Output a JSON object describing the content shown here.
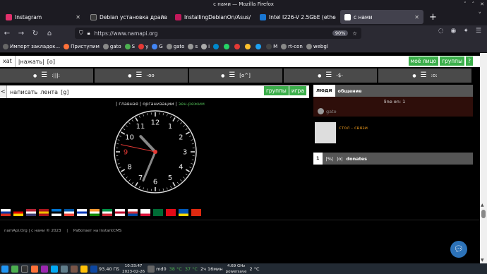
{
  "window": {
    "title": "с нами — Mozilla Firefox",
    "controls": [
      "˅",
      "˄",
      "✕"
    ]
  },
  "tabs": [
    {
      "label": "Instagram",
      "color": "#e1306c",
      "active": false
    },
    {
      "label": "Debian установка драйв",
      "color": "#3a3a3a",
      "active": false
    },
    {
      "label": "InstallingDebianOn/Asus/",
      "color": "#c2185b",
      "active": false
    },
    {
      "label": "Intel I226-V 2.5GbE (ethe",
      "color": "#1976d2",
      "active": false
    },
    {
      "label": "с нами",
      "color": "#ffffff",
      "active": true
    }
  ],
  "navbar": {
    "url": "https://www.namapi.org",
    "zoom": "90%"
  },
  "bookmarks": [
    {
      "label": "Импорт закладок...",
      "color": "#666"
    },
    {
      "label": "Приступим",
      "color": "#ff7139"
    },
    {
      "label": "gato",
      "color": "#888"
    },
    {
      "label": "S",
      "color": "#4caf50"
    },
    {
      "label": "y",
      "color": "#e53935"
    },
    {
      "label": "G",
      "color": "#4285f4"
    },
    {
      "label": "gato",
      "color": "#888"
    },
    {
      "label": "s",
      "color": "#999"
    },
    {
      "label": "i",
      "color": "#aaa"
    },
    {
      "label": "",
      "color": "#0088cc"
    },
    {
      "label": "",
      "color": "#25d366"
    },
    {
      "label": "",
      "color": "#e53935"
    },
    {
      "label": "",
      "color": "#fbc02d"
    },
    {
      "label": "",
      "color": "#1da1f2"
    },
    {
      "label": "M",
      "color": "#444"
    },
    {
      "label": "rt-con",
      "color": "#888"
    },
    {
      "label": "webgl",
      "color": "#888"
    }
  ],
  "site": {
    "xat": "xat",
    "press": "|нажать|",
    "o": "[o]",
    "my_face": "моё лицо",
    "groups": "группы",
    "help": "?",
    "filters": [
      ":|||:",
      "-oo",
      "[o^]",
      "-$-",
      ":o:"
    ],
    "left_bar": {
      "back": "<",
      "write": "написать",
      "feed": "лента",
      "g": "[g]",
      "groups": "группы",
      "game": "игра"
    },
    "nav_links": {
      "main": "главная",
      "orgs": "организации",
      "zen": "зен-режим"
    },
    "people": {
      "tab": "люди",
      "label": "общение",
      "line_on": "line on: 1",
      "guest": "gato"
    },
    "post_title": "стол - связи",
    "donate": {
      "num": "1",
      "pct": "|%|",
      "o": "|o|",
      "label": "donates"
    },
    "footer": {
      "site": "namApi.Org | с нами © 2023",
      "cms": "Работает на InstantCMS"
    }
  },
  "flags": [
    {
      "name": "russia",
      "colors": [
        "#fff",
        "#0039a6",
        "#d52b1e"
      ]
    },
    {
      "name": "germany",
      "colors": [
        "#000",
        "#dd0000",
        "#ffce00"
      ]
    },
    {
      "name": "usa",
      "colors": [
        "#b22234",
        "#fff",
        "#3c3b6e"
      ]
    },
    {
      "name": "spain",
      "colors": [
        "#aa151b",
        "#f1bf00",
        "#aa151b"
      ]
    },
    {
      "name": "estonia",
      "colors": [
        "#0072ce",
        "#000",
        "#fff"
      ]
    },
    {
      "name": "france",
      "colors": [
        "#0055a4",
        "#fff",
        "#ef4135"
      ]
    },
    {
      "name": "israel",
      "colors": [
        "#fff",
        "#0038b8",
        "#fff"
      ]
    },
    {
      "name": "india",
      "colors": [
        "#ff9933",
        "#fff",
        "#138808"
      ]
    },
    {
      "name": "italy",
      "colors": [
        "#009246",
        "#fff",
        "#ce2b37"
      ]
    },
    {
      "name": "japan",
      "colors": [
        "#fff",
        "#bc002d",
        "#fff"
      ]
    },
    {
      "name": "korea",
      "colors": [
        "#fff",
        "#cd2e3a",
        "#0047a0"
      ]
    },
    {
      "name": "poland",
      "colors": [
        "#fff",
        "#fff",
        "#dc143c"
      ]
    },
    {
      "name": "saudi",
      "colors": [
        "#006c35",
        "#006c35",
        "#006c35"
      ]
    },
    {
      "name": "turkey",
      "colors": [
        "#e30a17",
        "#e30a17",
        "#e30a17"
      ]
    },
    {
      "name": "ukraine",
      "colors": [
        "#0057b7",
        "#0057b7",
        "#ffd700"
      ]
    },
    {
      "name": "china",
      "colors": [
        "#de2910",
        "#de2910",
        "#de2910"
      ]
    }
  ],
  "taskbar": {
    "memory": "93.40 ГБ",
    "time": "10:33:47",
    "date": "2023-02-26",
    "disk": "md0",
    "temp1": "38 °C",
    "temp2": "37 °C",
    "uptime": "2ч 16мин",
    "freq": "4.69 GHz",
    "mode": "powersave",
    "weather": "2 °C"
  },
  "clock": {
    "hour": 10,
    "minute": 33,
    "second": 47,
    "numbers": [
      "12",
      "1",
      "2",
      "3",
      "4",
      "5",
      "6",
      "7",
      "8",
      "9",
      "10",
      "11"
    ]
  }
}
